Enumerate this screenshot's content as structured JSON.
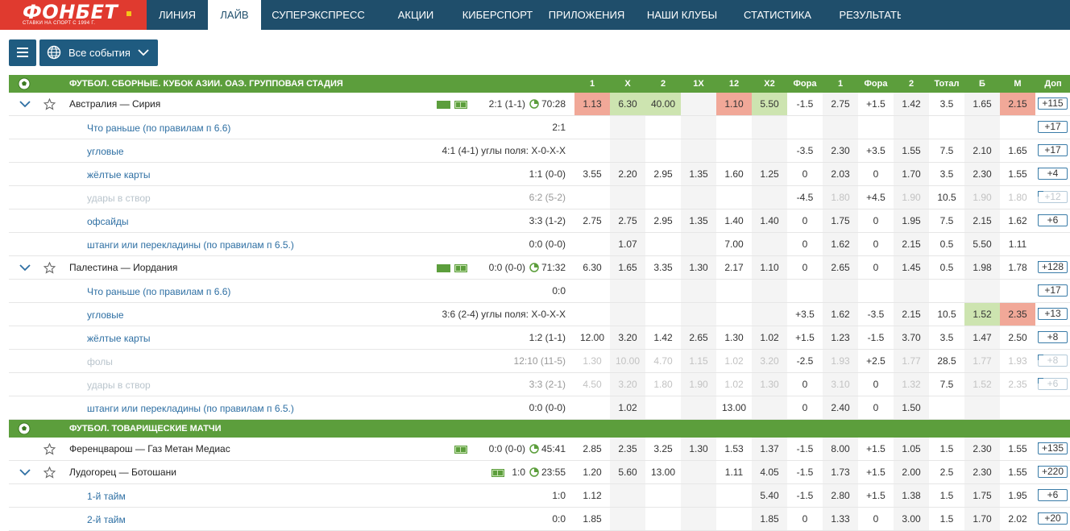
{
  "brand": {
    "name": "ФОНБЕТ",
    "tagline": "СТАВКИ НА СПОРТ С 1994 Г.",
    "accent": "#e03a2f",
    "nav_bg": "#1f4e6b",
    "green": "#5c9e3c"
  },
  "nav": [
    "ЛИНИЯ",
    "ЛАЙВ",
    "СУПЕРЭКСПРЕСС",
    "АКЦИИ",
    "КИБЕРСПОРТ",
    "ПРИЛОЖЕНИЯ",
    "НАШИ КЛУБЫ",
    "СТАТИСТИКА",
    "РЕЗУЛЬТАТЫ"
  ],
  "nav_active": "ЛАЙВ",
  "filter": {
    "label": "Все события",
    "icon": "globe-icon"
  },
  "columns": [
    "1",
    "X",
    "2",
    "1X",
    "12",
    "X2",
    "Фора",
    "1",
    "Фора",
    "2",
    "Тотал",
    "Б",
    "М",
    "Доп"
  ],
  "sections": [
    {
      "title": "ФУТБОЛ. СБОРНЫЕ. КУБОК АЗИИ. ОАЭ. ГРУППОВАЯ СТАДИЯ",
      "rows": [
        {
          "type": "match",
          "name": "Австралия — Сирия",
          "score": "2:1  (1-1)",
          "time": "70:28",
          "tv": true,
          "odds": [
            "1.13",
            "6.30",
            "40.00",
            "",
            "1.10",
            "5.50",
            "-1.5",
            "2.75",
            "+1.5",
            "1.42",
            "3.5",
            "1.65",
            "2.15"
          ],
          "hl": {
            "0": "red",
            "1": "green",
            "2": "green",
            "4": "red",
            "5": "green",
            "12": "red"
          },
          "more": "+115"
        },
        {
          "type": "sub",
          "name": "Что раньше (по правилам п 6.6)",
          "score": "2:1",
          "odds": [
            "",
            "",
            "",
            "",
            "",
            "",
            "",
            "",
            "",
            "",
            "",
            "",
            ""
          ],
          "more": "+17"
        },
        {
          "type": "sub",
          "name": "угловые",
          "score": "4:1  (4-1) углы поля: X-0-X-X",
          "odds": [
            "",
            "",
            "",
            "",
            "",
            "",
            "-3.5",
            "2.30",
            "+3.5",
            "1.55",
            "7.5",
            "2.10",
            "1.65"
          ],
          "more": "+17"
        },
        {
          "type": "sub",
          "name": "жёлтые карты",
          "score": "1:1  (0-0)",
          "odds": [
            "3.55",
            "2.20",
            "2.95",
            "1.35",
            "1.60",
            "1.25",
            "0",
            "2.03",
            "0",
            "1.70",
            "3.5",
            "2.30",
            "1.55"
          ],
          "more": "+4"
        },
        {
          "type": "sub",
          "dim": true,
          "name": "удары в створ",
          "score": "6:2  (5-2)",
          "odds": [
            "",
            "",
            "",
            "",
            "",
            "",
            "-4.5",
            "1.80",
            "+4.5",
            "1.90",
            "10.5",
            "1.90",
            "1.80"
          ],
          "dimcols": [
            7,
            9,
            11,
            12
          ],
          "more": "+12"
        },
        {
          "type": "sub",
          "name": "офсайды",
          "score": "3:3  (1-2)",
          "odds": [
            "2.75",
            "2.75",
            "2.95",
            "1.35",
            "1.40",
            "1.40",
            "0",
            "1.75",
            "0",
            "1.95",
            "7.5",
            "2.15",
            "1.62"
          ],
          "more": "+6"
        },
        {
          "type": "sub",
          "name": "штанги или перекладины (по правилам п 6.5.)",
          "score": "0:0  (0-0)",
          "odds": [
            "",
            "1.07",
            "",
            "",
            "7.00",
            "",
            "0",
            "1.62",
            "0",
            "2.15",
            "0.5",
            "5.50",
            "1.11"
          ],
          "more": ""
        },
        {
          "type": "match",
          "name": "Палестина — Иордания",
          "score": "0:0  (0-0)",
          "time": "71:32",
          "tv": true,
          "odds": [
            "6.30",
            "1.65",
            "3.35",
            "1.30",
            "2.17",
            "1.10",
            "0",
            "2.65",
            "0",
            "1.45",
            "0.5",
            "1.98",
            "1.78"
          ],
          "more": "+128"
        },
        {
          "type": "sub",
          "name": "Что раньше (по правилам п 6.6)",
          "score": "0:0",
          "odds": [
            "",
            "",
            "",
            "",
            "",
            "",
            "",
            "",
            "",
            "",
            "",
            "",
            ""
          ],
          "more": "+17"
        },
        {
          "type": "sub",
          "name": "угловые",
          "score": "3:6  (2-4) углы поля: X-0-X-X",
          "odds": [
            "",
            "",
            "",
            "",
            "",
            "",
            "+3.5",
            "1.62",
            "-3.5",
            "2.15",
            "10.5",
            "1.52",
            "2.35"
          ],
          "hl": {
            "11": "green",
            "12": "red"
          },
          "more": "+13"
        },
        {
          "type": "sub",
          "name": "жёлтые карты",
          "score": "1:2  (1-1)",
          "odds": [
            "12.00",
            "3.20",
            "1.42",
            "2.65",
            "1.30",
            "1.02",
            "+1.5",
            "1.23",
            "-1.5",
            "3.70",
            "3.5",
            "1.47",
            "2.50"
          ],
          "more": "+8"
        },
        {
          "type": "sub",
          "dim": true,
          "name": "фолы",
          "score": "12:10  (11-5)",
          "odds": [
            "1.30",
            "10.00",
            "4.70",
            "1.15",
            "1.02",
            "3.20",
            "-2.5",
            "1.93",
            "+2.5",
            "1.77",
            "28.5",
            "1.77",
            "1.93"
          ],
          "dimcols": [
            0,
            1,
            2,
            3,
            4,
            5,
            7,
            9,
            11,
            12
          ],
          "more": "+8"
        },
        {
          "type": "sub",
          "dim": true,
          "name": "удары в створ",
          "score": "3:3  (2-1)",
          "odds": [
            "4.50",
            "3.20",
            "1.80",
            "1.90",
            "1.02",
            "1.30",
            "0",
            "3.10",
            "0",
            "1.32",
            "7.5",
            "1.52",
            "2.35"
          ],
          "dimcols": [
            0,
            1,
            2,
            3,
            4,
            5,
            7,
            9,
            11,
            12
          ],
          "more": "+6"
        },
        {
          "type": "sub",
          "name": "штанги или перекладины (по правилам п 6.5.)",
          "score": "0:0  (0-0)",
          "odds": [
            "",
            "1.02",
            "",
            "",
            "13.00",
            "",
            "0",
            "2.40",
            "0",
            "1.50",
            "",
            "",
            ""
          ],
          "more": ""
        }
      ]
    },
    {
      "title": "ФУТБОЛ. ТОВАРИЩЕСКИЕ МАТЧИ",
      "rows": [
        {
          "type": "match",
          "nochev": true,
          "name": "Ференцварош — Газ Метан Медиас",
          "score": "0:0  (0-0)",
          "time": "45:41",
          "tv": false,
          "odds": [
            "2.85",
            "2.35",
            "3.25",
            "1.30",
            "1.53",
            "1.37",
            "-1.5",
            "8.00",
            "+1.5",
            "1.05",
            "1.5",
            "2.30",
            "1.55"
          ],
          "more": "+135"
        },
        {
          "type": "match",
          "name": "Лудогорец — Ботошани",
          "score": "1:0",
          "time": "23:55",
          "tv": false,
          "odds": [
            "1.20",
            "5.60",
            "13.00",
            "",
            "1.11",
            "4.05",
            "-1.5",
            "1.73",
            "+1.5",
            "2.00",
            "2.5",
            "2.30",
            "1.55"
          ],
          "more": "+220"
        },
        {
          "type": "sub",
          "name": "1-й тайм",
          "score": "1:0",
          "odds": [
            "1.12",
            "",
            "",
            "",
            "",
            "5.40",
            "-1.5",
            "2.80",
            "+1.5",
            "1.38",
            "1.5",
            "1.75",
            "1.95"
          ],
          "more": "+6"
        },
        {
          "type": "sub",
          "name": "2-й тайм",
          "score": "0:0",
          "odds": [
            "1.85",
            "",
            "",
            "",
            "",
            "1.85",
            "0",
            "1.33",
            "0",
            "3.00",
            "1.5",
            "1.70",
            "2.02"
          ],
          "more": "+20"
        }
      ]
    }
  ]
}
